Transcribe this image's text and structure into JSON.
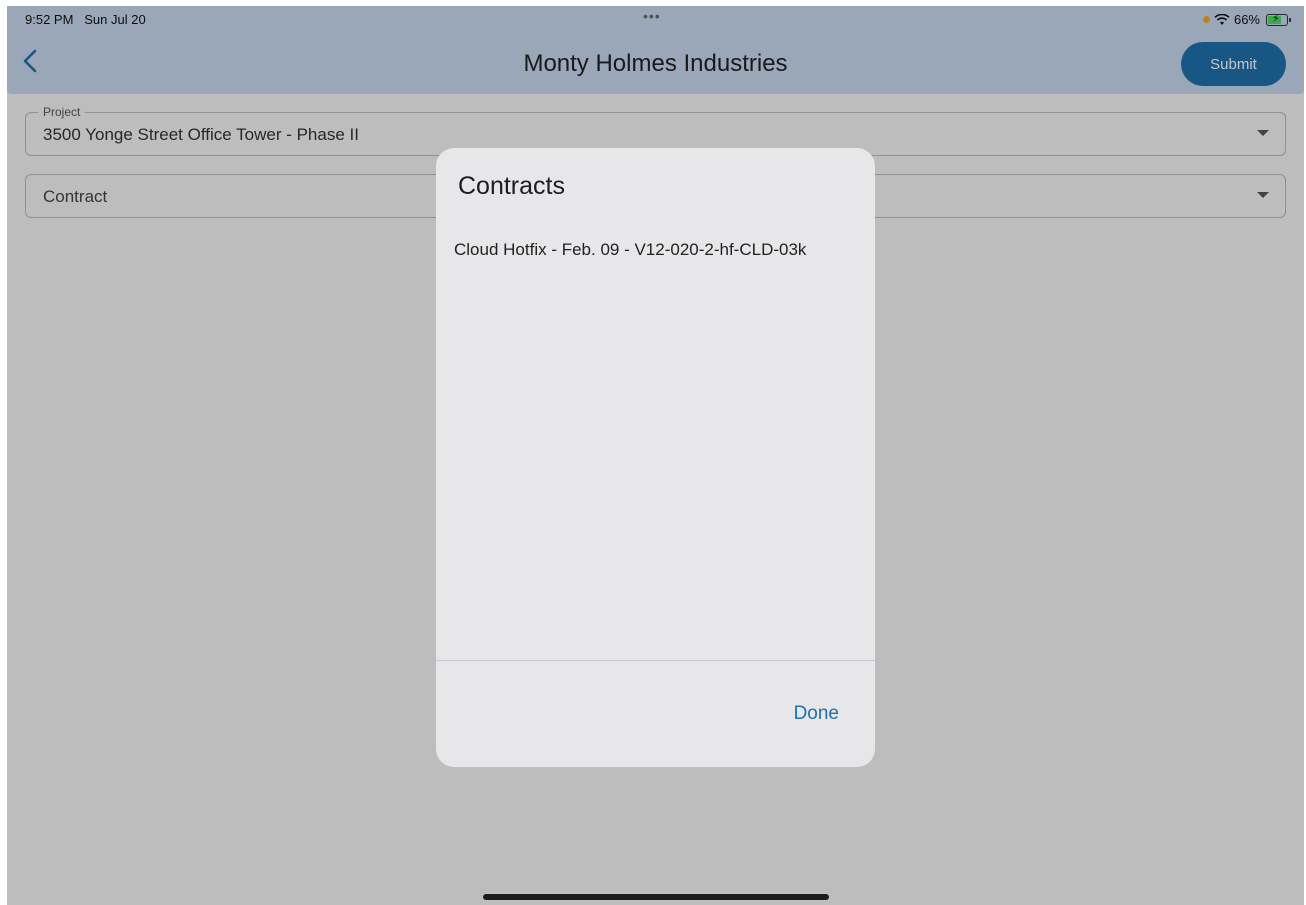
{
  "status_bar": {
    "time": "9:52 PM",
    "date": "Sun Jul 20",
    "dots": "•••",
    "battery": "66%"
  },
  "header": {
    "back_icon": "chevron-left-icon",
    "title": "Monty Holmes Industries",
    "submit_label": "Submit"
  },
  "form": {
    "project": {
      "label": "Project",
      "value": "3500 Yonge Street Office Tower - Phase II"
    },
    "contract": {
      "value": "Contract"
    }
  },
  "dialog": {
    "title": "Contracts",
    "items": [
      "Cloud Hotfix - Feb. 09 - V12-020-2-hf-CLD-03k"
    ],
    "done_label": "Done"
  },
  "colors": {
    "accent": "#1f6fa8",
    "header_bg": "#c5d7ed",
    "dialog_bg": "#e7e7ea"
  }
}
